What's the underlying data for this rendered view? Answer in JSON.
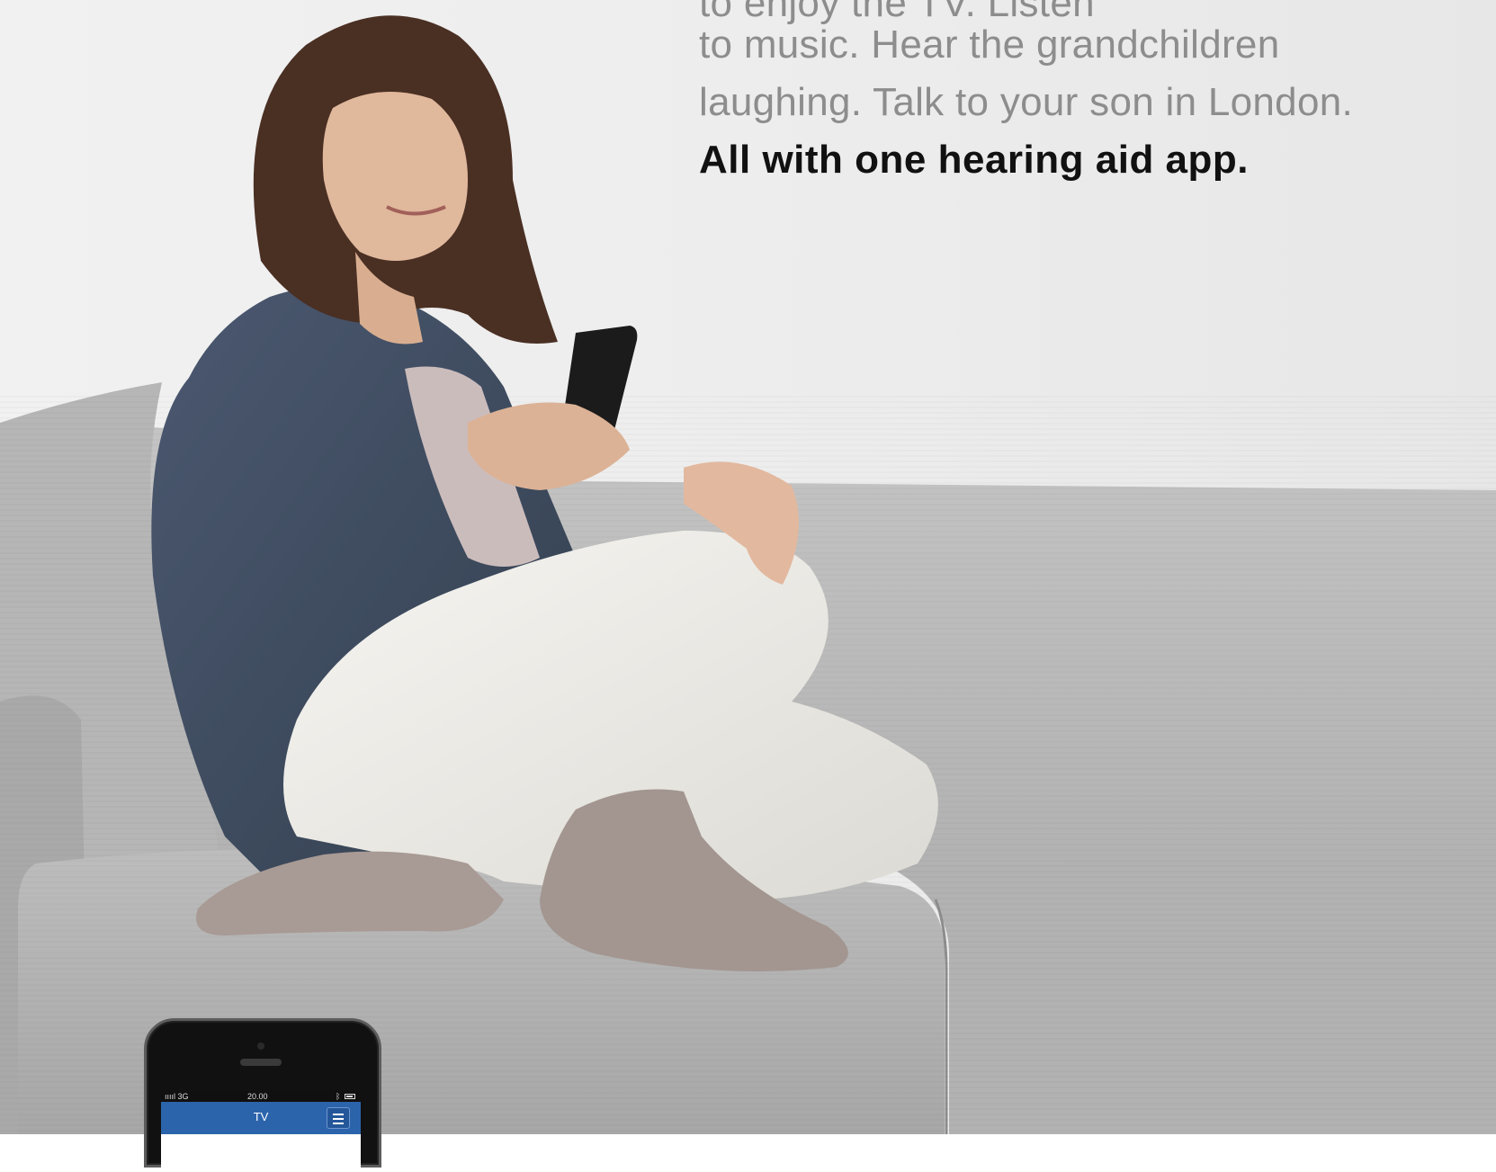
{
  "headline": {
    "line_faded": "to enjoy the TV. Listen",
    "line_1": "to music. Hear the grandchildren",
    "line_2": "laughing. Talk to your son in London.",
    "tagline": "All with one hearing aid app."
  },
  "phone_screen": {
    "signal": "ııııl 3G",
    "time": "20.00",
    "bluetooth_glyph": "ᛒ",
    "app_title": "TV",
    "menu_icon": "hamburger-menu-icon"
  },
  "colors": {
    "wall": "#ececec",
    "sofa": "#b4b4b4",
    "cardigan": "#3e4a5e",
    "trousers": "#eceae4",
    "app_bar": "#2c64ac",
    "headline_gray": "#8d8d8d",
    "tagline_black": "#111111"
  }
}
